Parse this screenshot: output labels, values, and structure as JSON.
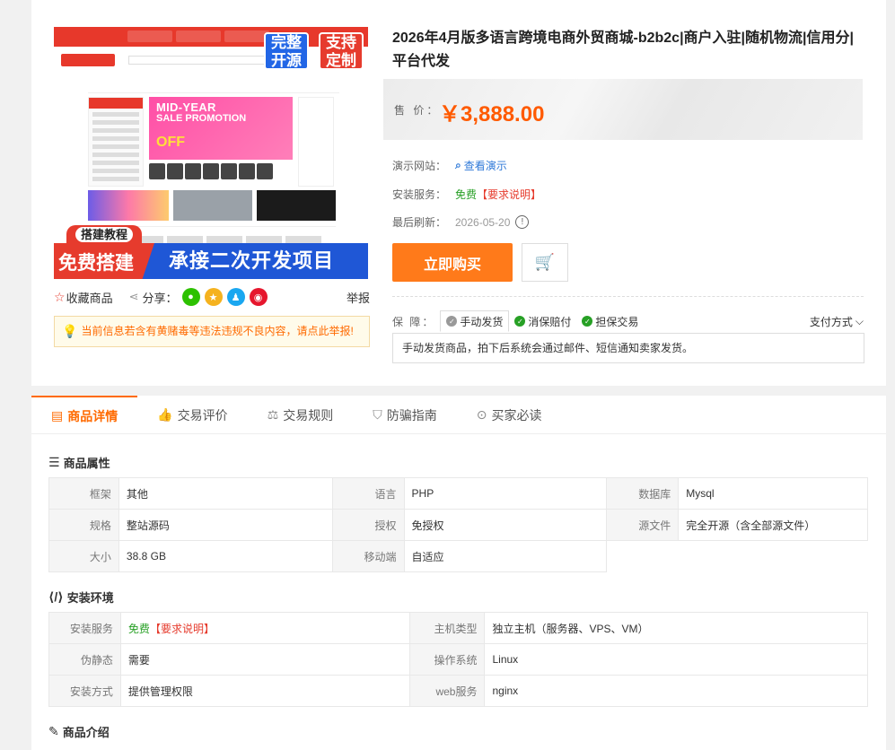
{
  "product": {
    "title": "2026年4月版多语言跨境电商外贸商城-b2b2c|商户入驻|随机物流|信用分|平台代发",
    "price_label": "售 价：",
    "price": "￥3,888.00"
  },
  "image": {
    "badge_red": "支持定制",
    "badge_blue": "完整开源",
    "tag": "搭建教程",
    "bottom_red": "免费搭建",
    "bottom_blue": "承接二次开发项目",
    "banner_line1": "MID-YEAR",
    "banner_line2": "SALE PROMOTION",
    "banner_line3": "OFF"
  },
  "share_bar": {
    "favorite": "收藏商品",
    "share": "分享：",
    "report": "举报",
    "icons": [
      "wechat-icon",
      "qzone-icon",
      "qq-icon",
      "weibo-icon"
    ],
    "colors": [
      "#2dc100",
      "#f5b21e",
      "#1aa7f0",
      "#e6162d"
    ]
  },
  "notice": "当前信息若含有黄赌毒等违法违规不良内容，请点此举报!",
  "info": {
    "demo_label": "演示网站：",
    "demo_link": "查看演示",
    "install_label": "安装服务：",
    "install_free": "免费",
    "install_req": "【要求说明】",
    "refresh_label": "最后刷新：",
    "refresh_date": "2026-05-20"
  },
  "buttons": {
    "buy": "立即购买"
  },
  "guarantee": {
    "label": "保 障：",
    "items": [
      "手动发货",
      "消保赔付",
      "担保交易"
    ],
    "item_colors": [
      "#999999",
      "#27a025",
      "#27a025"
    ],
    "pay": "支付方式",
    "desc": "手动发货商品，拍下后系统会通过邮件、短信通知卖家发货。"
  },
  "tabs": [
    "商品详情",
    "交易评价",
    "交易规则",
    "防骗指南",
    "买家必读"
  ],
  "attributes": {
    "title": "商品属性",
    "rows": [
      [
        [
          "框架",
          "其他"
        ],
        [
          "语言",
          "PHP"
        ],
        [
          "数据库",
          "Mysql"
        ]
      ],
      [
        [
          "规格",
          "整站源码"
        ],
        [
          "授权",
          "免授权"
        ],
        [
          "源文件",
          "完全开源（含全部源文件）"
        ]
      ],
      [
        [
          "大小",
          "38.8 GB"
        ],
        [
          "移动端",
          "自适应"
        ],
        [
          "",
          ""
        ]
      ]
    ]
  },
  "environment": {
    "title": "安装环境",
    "rows": [
      [
        [
          "安装服务",
          "免费"
        ],
        [
          "主机类型",
          "独立主机（服务器、VPS、VM）"
        ]
      ],
      [
        [
          "伪静态",
          "需要"
        ],
        [
          "操作系统",
          "Linux"
        ]
      ],
      [
        [
          "安装方式",
          "提供管理权限"
        ],
        [
          "web服务",
          "nginx"
        ]
      ]
    ],
    "install_req": "【要求说明】"
  },
  "intro": {
    "title": "商品介绍"
  },
  "colors": {
    "accent": "#ff6a00",
    "price": "#ff5a00",
    "buy_button": "#ff7a1a",
    "link": "#2f79d8",
    "free": "#27a025",
    "warn": "#e63b2d"
  }
}
